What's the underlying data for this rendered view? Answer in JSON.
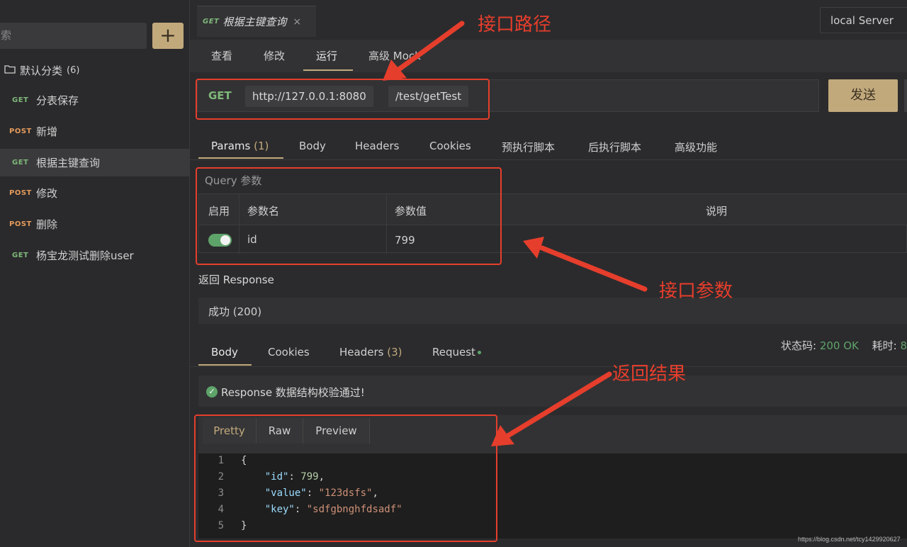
{
  "sidebar": {
    "search_placeholder": "搜索",
    "search_visible": "搜索",
    "add_label": "+",
    "folder": {
      "label": "默认分类",
      "count": "(6)"
    },
    "items": [
      {
        "method": "GET",
        "label": "分表保存"
      },
      {
        "method": "POST",
        "label": "新增"
      },
      {
        "method": "GET",
        "label": "根据主键查询"
      },
      {
        "method": "POST",
        "label": "修改"
      },
      {
        "method": "POST",
        "label": "删除"
      },
      {
        "method": "GET",
        "label": "杨宝龙测试删除user"
      }
    ]
  },
  "tab": {
    "method": "GET",
    "title": "根据主键查询",
    "close": "×"
  },
  "environment": "local Server",
  "subtabs": [
    "查看",
    "修改",
    "运行",
    "高级 Mock"
  ],
  "request": {
    "method": "GET",
    "host": "http://127.0.0.1:8080",
    "path": "/test/getTest",
    "send_label": "发送"
  },
  "request_tabs": {
    "params": "Params",
    "params_count": "(1)",
    "body": "Body",
    "headers": "Headers",
    "cookies": "Cookies",
    "pre_script": "预执行脚本",
    "post_script": "后执行脚本",
    "advanced": "高级功能"
  },
  "query": {
    "title": "Query 参数",
    "columns": [
      "启用",
      "参数名",
      "参数值",
      "说明"
    ],
    "rows": [
      {
        "enabled": true,
        "name": "id",
        "value": "799",
        "desc": ""
      }
    ]
  },
  "response": {
    "title": "返回 Response",
    "status_text": "成功 (200)",
    "tabs": {
      "body": "Body",
      "cookies": "Cookies",
      "headers": "Headers",
      "headers_count": "(3)",
      "request": "Request"
    },
    "status_code_label": "状态码:",
    "status_code_value": "200 OK",
    "time_label": "耗时:",
    "time_value": "8",
    "validation": "Response 数据结构校验通过!",
    "formats": [
      "Pretty",
      "Raw",
      "Preview"
    ],
    "code_lines": [
      {
        "num": "1",
        "text": "{"
      },
      {
        "num": "2",
        "key": "\"id\"",
        "sep": ": ",
        "val": "799",
        "end": ","
      },
      {
        "num": "3",
        "key": "\"value\"",
        "sep": ": ",
        "val": "\"123dsfs\"",
        "end": ","
      },
      {
        "num": "4",
        "key": "\"key\"",
        "sep": ": ",
        "val": "\"sdfgbnghfdsadf\"",
        "end": ""
      },
      {
        "num": "5",
        "text": "}"
      }
    ]
  },
  "annotations": {
    "path": "接口路径",
    "params": "接口参数",
    "result": "返回结果",
    "color": "#e63e2c"
  },
  "watermark": "https://blog.csdn.net/tcy1429920627"
}
